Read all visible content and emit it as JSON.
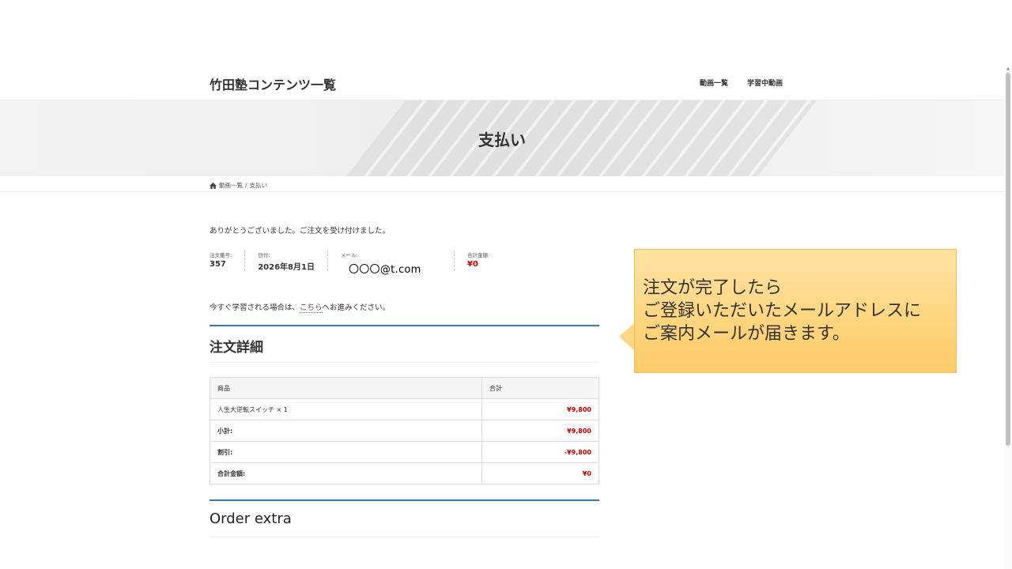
{
  "header": {
    "site_title": "竹田塾コンテンツ一覧",
    "nav": [
      {
        "label": "動画一覧"
      },
      {
        "label": "学習中動画"
      }
    ]
  },
  "hero": {
    "title": "支払い"
  },
  "breadcrumb": {
    "icon": "home-icon",
    "items": [
      "動画一覧",
      "/",
      "支払い"
    ]
  },
  "main": {
    "thanks": "ありがとうございました。ご注文を受け付けました。",
    "overview": {
      "order_label": "注文番号:",
      "order_value": "357",
      "date_label": "日付:",
      "date_value": "2026年8月1日",
      "email_label": "メール:",
      "email_value": "〇〇〇@t.com",
      "total_label": "合計金額:",
      "total_value": "¥0"
    },
    "learn_now": {
      "prefix": "今すぐ学習される場合は、",
      "link": "こちら",
      "suffix": "へお進みください。"
    },
    "order_details": {
      "heading": "注文詳細",
      "col_product": "商品",
      "col_total": "合計",
      "item_name": "人生大逆転スイッチ × 1",
      "item_price": "¥9,800",
      "subtotal_label": "小計:",
      "subtotal_value": "¥9,800",
      "discount_label": "割引:",
      "discount_value": "-¥9,800",
      "total_label": "合計金額:",
      "total_value": "¥0"
    },
    "order_extra": {
      "heading": "Order extra"
    }
  },
  "callout": {
    "line1": "注文が完了したら",
    "line2": "ご登録いただいたメールアドレスに",
    "line3": "ご案内メールが届きます。",
    "color": "#ffd47d"
  }
}
